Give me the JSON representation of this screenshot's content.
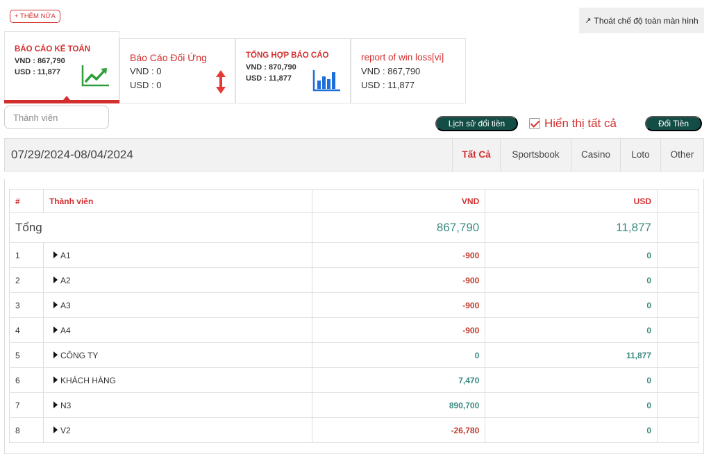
{
  "toolbar": {
    "add_more_label": "+ THÊM NỮA",
    "exit_fullscreen_label": "Thoát chế độ toàn màn hình",
    "exit_icon": "compress-arrows-icon"
  },
  "cards": [
    {
      "title": "BÁO CÁO KẾ TOÁN",
      "line1": "VND : 867,790",
      "line2": "USD : 11,877",
      "icon": "trend-up-chart-icon",
      "active": true
    },
    {
      "title": "Báo Cáo Đối Ứng",
      "line1": "VND : 0",
      "line2": "USD : 0",
      "icon": "vertical-arrows-icon",
      "active": false
    },
    {
      "title": "TỔNG HỢP BÁO CÁO",
      "line1": "VND : 870,790",
      "line2": "USD : 11,877",
      "icon": "bar-chart-icon",
      "active": false
    },
    {
      "title": "report of win loss[vi]",
      "line1": "VND : 867,790",
      "line2": "USD : 11,877",
      "icon": "",
      "active": false
    }
  ],
  "search": {
    "placeholder": "Thành viên",
    "value": ""
  },
  "actions": {
    "history_label": "Lịch sử đổi tiền",
    "show_all_label": "Hiển thị tất cả",
    "show_all_checked": true,
    "exchange_label": "Đổi Tiền"
  },
  "filter": {
    "date_range": "07/29/2024-08/04/2024",
    "tabs": [
      {
        "label": "Tất Cả",
        "active": true
      },
      {
        "label": "Sportsbook",
        "active": false
      },
      {
        "label": "Casino",
        "active": false
      },
      {
        "label": "Loto",
        "active": false
      },
      {
        "label": "Other",
        "active": false
      }
    ]
  },
  "table": {
    "headers": {
      "index": "#",
      "member": "Thành viên",
      "vnd": "VND",
      "usd": "USD"
    },
    "total": {
      "label": "Tổng",
      "vnd": "867,790",
      "usd": "11,877"
    },
    "rows": [
      {
        "index": "1",
        "name": "A1",
        "vnd": "-900",
        "usd": "0"
      },
      {
        "index": "2",
        "name": "A2",
        "vnd": "-900",
        "usd": "0"
      },
      {
        "index": "3",
        "name": "A3",
        "vnd": "-900",
        "usd": "0"
      },
      {
        "index": "4",
        "name": "A4",
        "vnd": "-900",
        "usd": "0"
      },
      {
        "index": "5",
        "name": "CÔNG TY",
        "vnd": "0",
        "usd": "11,877"
      },
      {
        "index": "6",
        "name": "KHÁCH HÀNG",
        "vnd": "7,470",
        "usd": "0"
      },
      {
        "index": "7",
        "name": "N3",
        "vnd": "890,700",
        "usd": "0"
      },
      {
        "index": "8",
        "name": "V2",
        "vnd": "-26,780",
        "usd": "0"
      }
    ]
  },
  "colors": {
    "accent": "#d32f2f",
    "teal": "#124d46",
    "positive": "#3a8a80",
    "negative": "#c0392b"
  }
}
